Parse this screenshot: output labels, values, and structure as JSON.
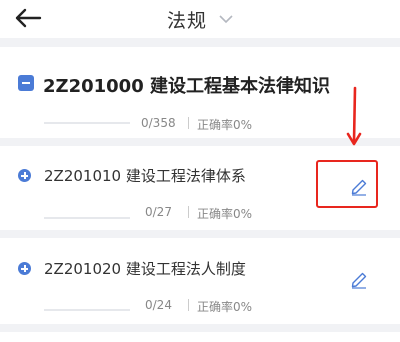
{
  "header": {
    "back_icon": "arrow-left-icon",
    "title": "法规",
    "dropdown_icon": "chevron-down-icon"
  },
  "section": {
    "icon": "collapse-square-icon",
    "title": "2Z201000 建设工程基本法律知识",
    "count": "0/358",
    "accuracy": "正确率0%",
    "progress": 0
  },
  "items": [
    {
      "icon": "expand-plus-icon",
      "title": "2Z201010 建设工程法律体系",
      "count": "0/27",
      "accuracy": "正确率0%",
      "progress": 0,
      "action_icon": "pencil-icon"
    },
    {
      "icon": "expand-plus-icon",
      "title": "2Z201020 建设工程法人制度",
      "count": "0/24",
      "accuracy": "正确率0%",
      "progress": 0,
      "action_icon": "pencil-icon"
    }
  ],
  "annotation": {
    "color": "#e8261e",
    "arrow_icon": "arrow-down-icon"
  },
  "colors": {
    "accent": "#4b7bd6",
    "background": "#f1f2f5"
  }
}
